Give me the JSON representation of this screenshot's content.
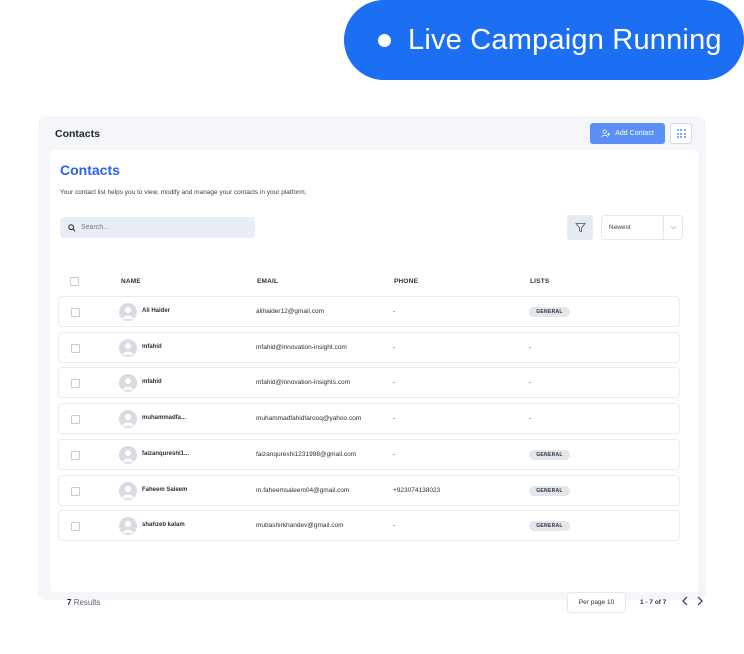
{
  "badge": {
    "label": "Live Campaign Running"
  },
  "header": {
    "title": "Contacts",
    "add_label": "Add Contact"
  },
  "content": {
    "heading": "Contacts",
    "subtitle": "Your contact list helps you to view, modify and manage your contacts in your platform.",
    "search_placeholder": "Search...",
    "sort_value": "Newest"
  },
  "table": {
    "columns": {
      "name": "NAME",
      "email": "EMAIL",
      "phone": "PHONE",
      "lists": "LISTS"
    },
    "rows": [
      {
        "name": "Ali Haider",
        "email": "alihaider12@gmail.com",
        "phone": "-",
        "list": "GENERAL"
      },
      {
        "name": "mfahid",
        "email": "mfahid@innovation-insight.com",
        "phone": "-",
        "list": "-"
      },
      {
        "name": "mfahid",
        "email": "mfahid@innovation-insights.com",
        "phone": "-",
        "list": "-"
      },
      {
        "name": "muhammadfa...",
        "email": "muhammadfahidfarooq@yahoo.com",
        "phone": "-",
        "list": "-"
      },
      {
        "name": "faizanqureshi1...",
        "email": "faizanqureshi1231998@gmail.com",
        "phone": "-",
        "list": "GENERAL"
      },
      {
        "name": "Faheem Saleem",
        "email": "m.faheemsaleem04@gmail.com",
        "phone": "+923074138023",
        "list": "GENERAL"
      },
      {
        "name": "shahzeb kalam",
        "email": "mubashirkhandev@gmail.com",
        "phone": "-",
        "list": "GENERAL"
      }
    ]
  },
  "footer": {
    "results_count": "7",
    "results_label": "Results",
    "per_page_label": "Per page 10",
    "page_range": "1 - 7",
    "page_of": "of 7"
  },
  "colors": {
    "brand": "#1c6ef2",
    "accent": "#2b64e8",
    "button": "#5b8ff6"
  }
}
